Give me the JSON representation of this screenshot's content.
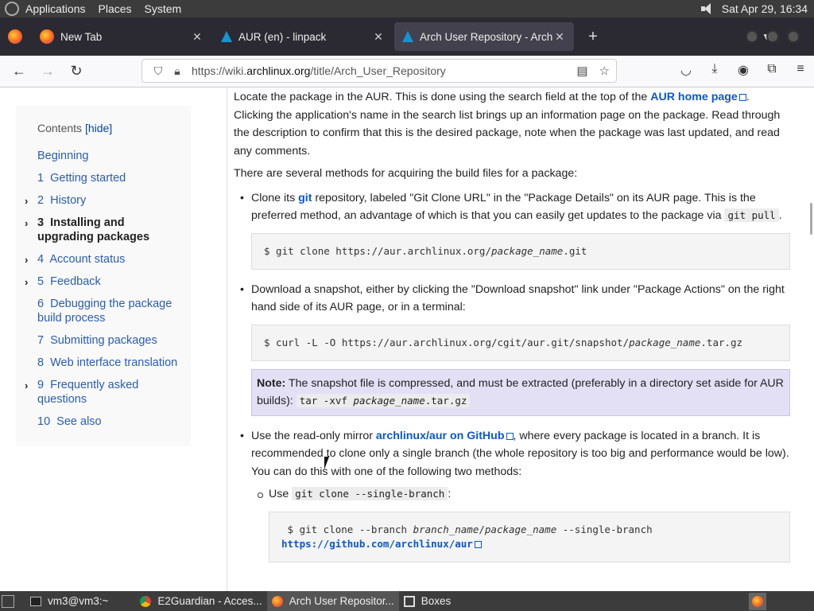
{
  "system_panel": {
    "menus": [
      "Applications",
      "Places",
      "System"
    ],
    "clock": "Sat Apr 29, 16:34"
  },
  "tabs": [
    {
      "title": "New Tab",
      "icon": "firefox-icon"
    },
    {
      "title": "AUR (en) - linpack",
      "icon": "arch-icon"
    },
    {
      "title": "Arch User Repository - Arch",
      "icon": "arch-icon",
      "active": true
    }
  ],
  "nav": {
    "url_prefix": "https://wiki.",
    "url_domain": "archlinux.org",
    "url_path": "/title/Arch_User_Repository"
  },
  "toc": {
    "title": "Contents",
    "hide": "[hide]",
    "items": [
      {
        "num": "",
        "label": "Beginning",
        "expandable": false
      },
      {
        "num": "1",
        "label": "Getting started",
        "expandable": false
      },
      {
        "num": "2",
        "label": "History",
        "expandable": true
      },
      {
        "num": "3",
        "label": "Installing and upgrading packages",
        "expandable": true,
        "current": true
      },
      {
        "num": "4",
        "label": "Account status",
        "expandable": true
      },
      {
        "num": "5",
        "label": "Feedback",
        "expandable": true
      },
      {
        "num": "6",
        "label": "Debugging the package build process",
        "expandable": false
      },
      {
        "num": "7",
        "label": "Submitting packages",
        "expandable": false
      },
      {
        "num": "8",
        "label": "Web interface translation",
        "expandable": false
      },
      {
        "num": "9",
        "label": "Frequently asked questions",
        "expandable": true
      },
      {
        "num": "10",
        "label": "See also",
        "expandable": false
      }
    ]
  },
  "content": {
    "p1_a": "Locate the package in the AUR. This is done using the search field at the top of the ",
    "p1_link": "AUR home page",
    "p1_b": ". Clicking the application's name in the search list brings up an information page on the package. Read through the description to confirm that this is the desired package, note when the package was last updated, and read any comments.",
    "p2": "There are several methods for acquiring the build files for a package:",
    "m1_a": "Clone its ",
    "m1_link": "git",
    "m1_b": " repository, labeled \"Git Clone URL\" in the \"Package Details\" on its AUR page. This is the preferred method, an advantage of which is that you can easily get updates to the package via ",
    "m1_code": "git pull",
    "m1_c": ".",
    "cmd1_a": "$ git clone https://aur.archlinux.org/",
    "cmd1_i": "package_name",
    "cmd1_b": ".git",
    "m2": "Download a snapshot, either by clicking the \"Download snapshot\" link under \"Package Actions\" on the right hand side of its AUR page, or in a terminal:",
    "cmd2_a": "$ curl -L -O https://aur.archlinux.org/cgit/aur.git/snapshot/",
    "cmd2_i": "package_name",
    "cmd2_b": ".tar.gz",
    "note_label": "Note:",
    "note_text": " The snapshot file is compressed, and must be extracted (preferably in a directory set aside for AUR builds): ",
    "note_code_a": "tar -xvf ",
    "note_code_i": "package_name",
    "note_code_b": ".tar.gz",
    "m3_a": "Use the read-only mirror ",
    "m3_link": "archlinux/aur on GitHub",
    "m3_b": ", where every package is located in a branch. It is recommended to clone only a single branch (the whole repository is too big and performance would be low). You can do this with one of the following two methods:",
    "sub1_a": "Use ",
    "sub1_code": "git clone --single-branch",
    "sub1_b": ":",
    "cmd3_a": " $ git clone --branch ",
    "cmd3_i1": "branch_name",
    "cmd3_sep": "/",
    "cmd3_i2": "package_name",
    "cmd3_b": " --single-branch ",
    "cmd3_link": "https://github.com/archlinux/aur"
  },
  "taskbar": {
    "items": [
      {
        "label": "vm3@vm3:~",
        "icon": "terminal-icon"
      },
      {
        "label": "E2Guardian - Acces...",
        "icon": "chrome-icon"
      },
      {
        "label": "Arch User Repositor...",
        "icon": "firefox-icon",
        "active": true
      },
      {
        "label": "Boxes",
        "icon": "boxes-icon"
      }
    ]
  }
}
